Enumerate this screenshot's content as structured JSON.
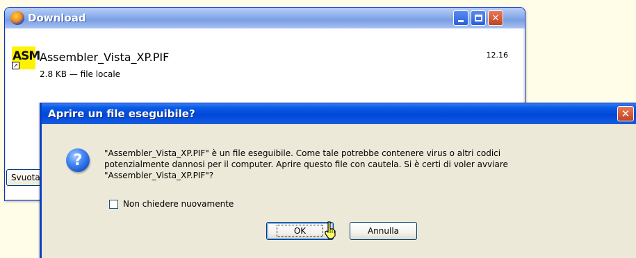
{
  "download_window": {
    "title": "Download",
    "item": {
      "icon_text": "ASM",
      "filename": "Assembler_Vista_XP.PIF",
      "meta": "2.8 KB — file locale",
      "time": "12.16"
    },
    "clear_button_label": "Svuota"
  },
  "dialog": {
    "title": "Aprire un file eseguibile?",
    "message_lines": [
      "\"Assembler_Vista_XP.PIF\" è un file eseguibile. Come tale potrebbe contenere virus o altri codici",
      "potenzialmente dannosi per il computer. Aprire questo file con cautela. Si è certi di voler avviare",
      "\"Assembler_Vista_XP.PIF\"?"
    ],
    "checkbox_label": "Non chiedere nuovamente",
    "checkbox_checked": false,
    "ok_label": "OK",
    "cancel_label": "Annulla"
  },
  "icons": {
    "title_app": "firefox-icon",
    "question": "question-icon",
    "cursor": "mouse-cursor-icon"
  },
  "colors": {
    "background": "#fffde8",
    "dialog_title": "#0047d8",
    "asm_icon": "#fff200"
  }
}
